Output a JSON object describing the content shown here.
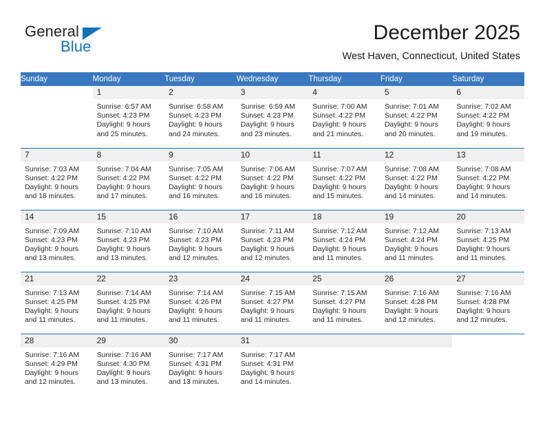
{
  "brand": {
    "word_one": "General",
    "word_two": "Blue",
    "logo_icon": "triangle-logo-icon"
  },
  "header": {
    "month_title": "December 2025",
    "location": "West Haven, Connecticut, United States"
  },
  "colors": {
    "header_blue": "#3a78bf",
    "separator_blue": "#1f6cb4",
    "daynum_band": "#f0f0f0",
    "brand_blue": "#1273bd",
    "text": "#2b2b2b"
  },
  "weekday_headers": [
    "Sunday",
    "Monday",
    "Tuesday",
    "Wednesday",
    "Thursday",
    "Friday",
    "Saturday"
  ],
  "weeks": [
    [
      {
        "day": "",
        "empty": true,
        "sunrise": "",
        "sunset": "",
        "daylight_line1": "",
        "daylight_line2": ""
      },
      {
        "day": "1",
        "sunrise": "Sunrise: 6:57 AM",
        "sunset": "Sunset: 4:23 PM",
        "daylight_line1": "Daylight: 9 hours",
        "daylight_line2": "and 25 minutes."
      },
      {
        "day": "2",
        "sunrise": "Sunrise: 6:58 AM",
        "sunset": "Sunset: 4:23 PM",
        "daylight_line1": "Daylight: 9 hours",
        "daylight_line2": "and 24 minutes."
      },
      {
        "day": "3",
        "sunrise": "Sunrise: 6:59 AM",
        "sunset": "Sunset: 4:23 PM",
        "daylight_line1": "Daylight: 9 hours",
        "daylight_line2": "and 23 minutes."
      },
      {
        "day": "4",
        "sunrise": "Sunrise: 7:00 AM",
        "sunset": "Sunset: 4:22 PM",
        "daylight_line1": "Daylight: 9 hours",
        "daylight_line2": "and 21 minutes."
      },
      {
        "day": "5",
        "sunrise": "Sunrise: 7:01 AM",
        "sunset": "Sunset: 4:22 PM",
        "daylight_line1": "Daylight: 9 hours",
        "daylight_line2": "and 20 minutes."
      },
      {
        "day": "6",
        "sunrise": "Sunrise: 7:02 AM",
        "sunset": "Sunset: 4:22 PM",
        "daylight_line1": "Daylight: 9 hours",
        "daylight_line2": "and 19 minutes."
      }
    ],
    [
      {
        "day": "7",
        "sunrise": "Sunrise: 7:03 AM",
        "sunset": "Sunset: 4:22 PM",
        "daylight_line1": "Daylight: 9 hours",
        "daylight_line2": "and 18 minutes."
      },
      {
        "day": "8",
        "sunrise": "Sunrise: 7:04 AM",
        "sunset": "Sunset: 4:22 PM",
        "daylight_line1": "Daylight: 9 hours",
        "daylight_line2": "and 17 minutes."
      },
      {
        "day": "9",
        "sunrise": "Sunrise: 7:05 AM",
        "sunset": "Sunset: 4:22 PM",
        "daylight_line1": "Daylight: 9 hours",
        "daylight_line2": "and 16 minutes."
      },
      {
        "day": "10",
        "sunrise": "Sunrise: 7:06 AM",
        "sunset": "Sunset: 4:22 PM",
        "daylight_line1": "Daylight: 9 hours",
        "daylight_line2": "and 16 minutes."
      },
      {
        "day": "11",
        "sunrise": "Sunrise: 7:07 AM",
        "sunset": "Sunset: 4:22 PM",
        "daylight_line1": "Daylight: 9 hours",
        "daylight_line2": "and 15 minutes."
      },
      {
        "day": "12",
        "sunrise": "Sunrise: 7:08 AM",
        "sunset": "Sunset: 4:22 PM",
        "daylight_line1": "Daylight: 9 hours",
        "daylight_line2": "and 14 minutes."
      },
      {
        "day": "13",
        "sunrise": "Sunrise: 7:08 AM",
        "sunset": "Sunset: 4:22 PM",
        "daylight_line1": "Daylight: 9 hours",
        "daylight_line2": "and 14 minutes."
      }
    ],
    [
      {
        "day": "14",
        "sunrise": "Sunrise: 7:09 AM",
        "sunset": "Sunset: 4:23 PM",
        "daylight_line1": "Daylight: 9 hours",
        "daylight_line2": "and 13 minutes."
      },
      {
        "day": "15",
        "sunrise": "Sunrise: 7:10 AM",
        "sunset": "Sunset: 4:23 PM",
        "daylight_line1": "Daylight: 9 hours",
        "daylight_line2": "and 13 minutes."
      },
      {
        "day": "16",
        "sunrise": "Sunrise: 7:10 AM",
        "sunset": "Sunset: 4:23 PM",
        "daylight_line1": "Daylight: 9 hours",
        "daylight_line2": "and 12 minutes."
      },
      {
        "day": "17",
        "sunrise": "Sunrise: 7:11 AM",
        "sunset": "Sunset: 4:23 PM",
        "daylight_line1": "Daylight: 9 hours",
        "daylight_line2": "and 12 minutes."
      },
      {
        "day": "18",
        "sunrise": "Sunrise: 7:12 AM",
        "sunset": "Sunset: 4:24 PM",
        "daylight_line1": "Daylight: 9 hours",
        "daylight_line2": "and 11 minutes."
      },
      {
        "day": "19",
        "sunrise": "Sunrise: 7:12 AM",
        "sunset": "Sunset: 4:24 PM",
        "daylight_line1": "Daylight: 9 hours",
        "daylight_line2": "and 11 minutes."
      },
      {
        "day": "20",
        "sunrise": "Sunrise: 7:13 AM",
        "sunset": "Sunset: 4:25 PM",
        "daylight_line1": "Daylight: 9 hours",
        "daylight_line2": "and 11 minutes."
      }
    ],
    [
      {
        "day": "21",
        "sunrise": "Sunrise: 7:13 AM",
        "sunset": "Sunset: 4:25 PM",
        "daylight_line1": "Daylight: 9 hours",
        "daylight_line2": "and 11 minutes."
      },
      {
        "day": "22",
        "sunrise": "Sunrise: 7:14 AM",
        "sunset": "Sunset: 4:25 PM",
        "daylight_line1": "Daylight: 9 hours",
        "daylight_line2": "and 11 minutes."
      },
      {
        "day": "23",
        "sunrise": "Sunrise: 7:14 AM",
        "sunset": "Sunset: 4:26 PM",
        "daylight_line1": "Daylight: 9 hours",
        "daylight_line2": "and 11 minutes."
      },
      {
        "day": "24",
        "sunrise": "Sunrise: 7:15 AM",
        "sunset": "Sunset: 4:27 PM",
        "daylight_line1": "Daylight: 9 hours",
        "daylight_line2": "and 11 minutes."
      },
      {
        "day": "25",
        "sunrise": "Sunrise: 7:15 AM",
        "sunset": "Sunset: 4:27 PM",
        "daylight_line1": "Daylight: 9 hours",
        "daylight_line2": "and 11 minutes."
      },
      {
        "day": "26",
        "sunrise": "Sunrise: 7:16 AM",
        "sunset": "Sunset: 4:28 PM",
        "daylight_line1": "Daylight: 9 hours",
        "daylight_line2": "and 12 minutes."
      },
      {
        "day": "27",
        "sunrise": "Sunrise: 7:16 AM",
        "sunset": "Sunset: 4:28 PM",
        "daylight_line1": "Daylight: 9 hours",
        "daylight_line2": "and 12 minutes."
      }
    ],
    [
      {
        "day": "28",
        "sunrise": "Sunrise: 7:16 AM",
        "sunset": "Sunset: 4:29 PM",
        "daylight_line1": "Daylight: 9 hours",
        "daylight_line2": "and 12 minutes."
      },
      {
        "day": "29",
        "sunrise": "Sunrise: 7:16 AM",
        "sunset": "Sunset: 4:30 PM",
        "daylight_line1": "Daylight: 9 hours",
        "daylight_line2": "and 13 minutes."
      },
      {
        "day": "30",
        "sunrise": "Sunrise: 7:17 AM",
        "sunset": "Sunset: 4:31 PM",
        "daylight_line1": "Daylight: 9 hours",
        "daylight_line2": "and 13 minutes."
      },
      {
        "day": "31",
        "sunrise": "Sunrise: 7:17 AM",
        "sunset": "Sunset: 4:31 PM",
        "daylight_line1": "Daylight: 9 hours",
        "daylight_line2": "and 14 minutes."
      },
      {
        "day": "",
        "empty": true,
        "gray_band": true,
        "sunrise": "",
        "sunset": "",
        "daylight_line1": "",
        "daylight_line2": ""
      },
      {
        "day": "",
        "empty": true,
        "gray_band": true,
        "sunrise": "",
        "sunset": "",
        "daylight_line1": "",
        "daylight_line2": ""
      },
      {
        "day": "",
        "empty": true,
        "sunrise": "",
        "sunset": "",
        "daylight_line1": "",
        "daylight_line2": ""
      }
    ]
  ]
}
